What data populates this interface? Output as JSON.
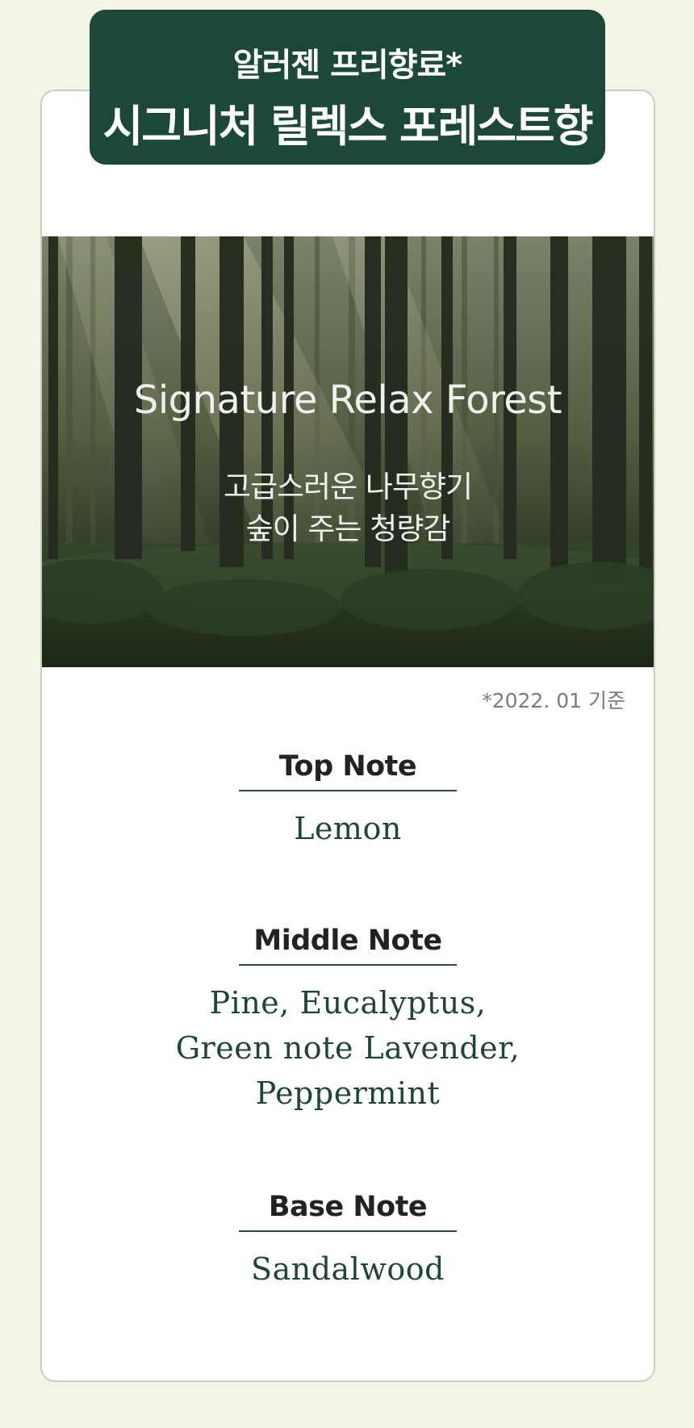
{
  "banner": {
    "subtitle": "알러젠 프리향료*",
    "title": "시그니처 릴렉스 포레스트향"
  },
  "hero": {
    "title": "Signature Relax Forest",
    "line1": "고급스러운 나무향기",
    "line2": "숲이 주는 청량감"
  },
  "footnote": "*2022. 01 기준",
  "notes": {
    "top": {
      "heading": "Top Note",
      "items": [
        "Lemon"
      ]
    },
    "middle": {
      "heading": "Middle Note",
      "items": [
        "Pine, Eucalyptus,",
        "Green note Lavender,",
        "Peppermint"
      ]
    },
    "base": {
      "heading": "Base Note",
      "items": [
        "Sandalwood"
      ]
    }
  },
  "colors": {
    "page_bg": "#f2f5e6",
    "banner_bg": "#1c4839",
    "note_text": "#1f4538",
    "card_border": "#c9ccc6"
  }
}
